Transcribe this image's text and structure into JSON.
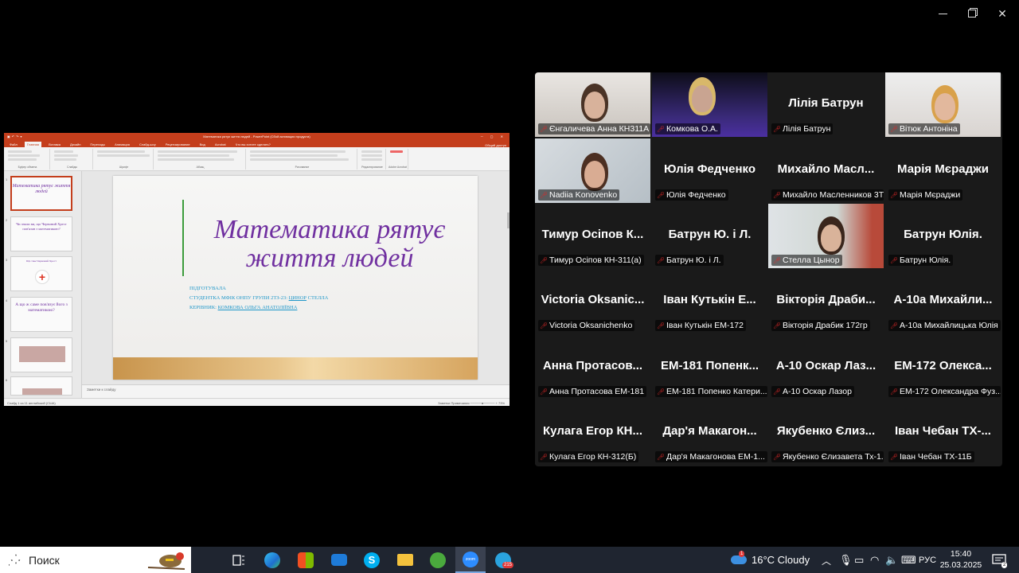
{
  "window": {
    "minimize_label": "",
    "maximize_label": "",
    "close_label": "✕"
  },
  "powerpoint": {
    "title_bar": "Математика рятує життя людей - PowerPoint (Сбой активации продукта)",
    "tabs": [
      "Файл",
      "Главная",
      "Вставка",
      "Дизайн",
      "Переходы",
      "Анимация",
      "Слайд-шоу",
      "Рецензирование",
      "Вид",
      "Acrobat",
      "Что вы хотите сделать?"
    ],
    "share": "Общий доступ",
    "ribbon_groups": [
      "Буфер обмена",
      "Слайды",
      "Шрифт",
      "Абзац",
      "Рисование",
      "Редактирование",
      "Adobe Acrobat"
    ],
    "thumb_numbers": [
      "1",
      "2",
      "3",
      "4",
      "5",
      "6"
    ],
    "thumbs": [
      "Математика рятує життя людей",
      "Чи знали ви, що Червоний Хрест пов'язан з математикою?",
      "Що таке Червоний Хрест",
      "А що ж саме пов'язує його з математикою?",
      "",
      ""
    ],
    "slide": {
      "title": "Математика рятує життя людей",
      "line1": "ПІДГОТУВАЛА",
      "line2_a": "СТУДЕНТКА МФІК ОНПУ ГРУПИ 2ТЗ-23: ",
      "line2_b": "ЦИНОР",
      "line2_c": " СТЕЛЛА",
      "line3_a": "КЕРІВНИК: ",
      "line3_b": "КОМКОВА ОЛЬГА АНАТОЛІЇВНА"
    },
    "notes": "Заметки к слайду",
    "status_left": "Слайд 1 из 11    английский (США)",
    "status_right": "Заметки    Примечания    ─────●───── + 73%"
  },
  "participants": [
    {
      "name": "Єнгаличева Анна КН311А",
      "big": "",
      "video": true
    },
    {
      "name": "Комкова О.А.",
      "big": "",
      "video": true
    },
    {
      "name": "Лілія Батрун",
      "big": "Лілія Батрун",
      "video": false
    },
    {
      "name": "Вітюк Антоніна",
      "big": "",
      "video": true
    },
    {
      "name": "Nadiia Konovenko",
      "big": "",
      "video": true
    },
    {
      "name": "Юлія Федченко",
      "big": "Юлія Федченко",
      "video": false
    },
    {
      "name": "Михайло Масленников 3Т...",
      "big": "Михайло Масл...",
      "video": false
    },
    {
      "name": "Марія Мєраджи",
      "big": "Марія Мєраджи",
      "video": false
    },
    {
      "name": "Тимур Осіпов КН-311(а)",
      "big": "Тимур Осіпов К...",
      "video": false
    },
    {
      "name": "Батрун Ю. і Л.",
      "big": "Батрун Ю. і Л.",
      "video": false
    },
    {
      "name": "Стелла Цынор",
      "big": "",
      "video": true
    },
    {
      "name": "Батрун Юлія.",
      "big": "Батрун Юлія.",
      "video": false
    },
    {
      "name": "Victoria Oksanichenko",
      "big": "Victoria Oksanic...",
      "video": false
    },
    {
      "name": "Іван Кутькін ЕМ-172",
      "big": "Іван Кутькін Е...",
      "video": false
    },
    {
      "name": "Вікторія Драбик 172гр",
      "big": "Вікторія Драби...",
      "video": false
    },
    {
      "name": "А-10а Михайлицька Юлія",
      "big": "А-10а Михайли...",
      "video": false
    },
    {
      "name": "Анна Протасова ЕМ-181",
      "big": "Анна Протасов...",
      "video": false
    },
    {
      "name": "ЕМ-181 Попенко Катери...",
      "big": "ЕМ-181 Попенк...",
      "video": false
    },
    {
      "name": "А-10 Оскар Лазор",
      "big": "А-10 Оскар Лаз...",
      "video": false
    },
    {
      "name": "ЕМ-172 Олександра Фуз...",
      "big": "ЕМ-172 Олекса...",
      "video": false
    },
    {
      "name": "Кулага Егор КН-312(Б)",
      "big": "Кулага Егор КН...",
      "video": false
    },
    {
      "name": "Дар'я Макагонова ЕМ-1...",
      "big": "Дар'я Макагон...",
      "video": false
    },
    {
      "name": "Якубенко Єлизавета Тх-1...",
      "big": "Якубенко Єлиз...",
      "video": false
    },
    {
      "name": "Іван Чебан ТХ-11Б",
      "big": "Іван Чебан ТХ-...",
      "video": false
    }
  ],
  "taskbar": {
    "search_placeholder": "Поиск",
    "telegram_badge": "215",
    "weather": "16°C  Cloudy",
    "weather_badge": "1",
    "language": "РУС",
    "time": "15:40",
    "date": "25.03.2025",
    "notif_count": "2"
  },
  "colors": {
    "ppt_accent": "#c43e1c",
    "slide_title": "#7030a0",
    "slide_sub": "#1f97c9",
    "active_speaker": "#23d959",
    "muted_mic": "#e02828"
  }
}
